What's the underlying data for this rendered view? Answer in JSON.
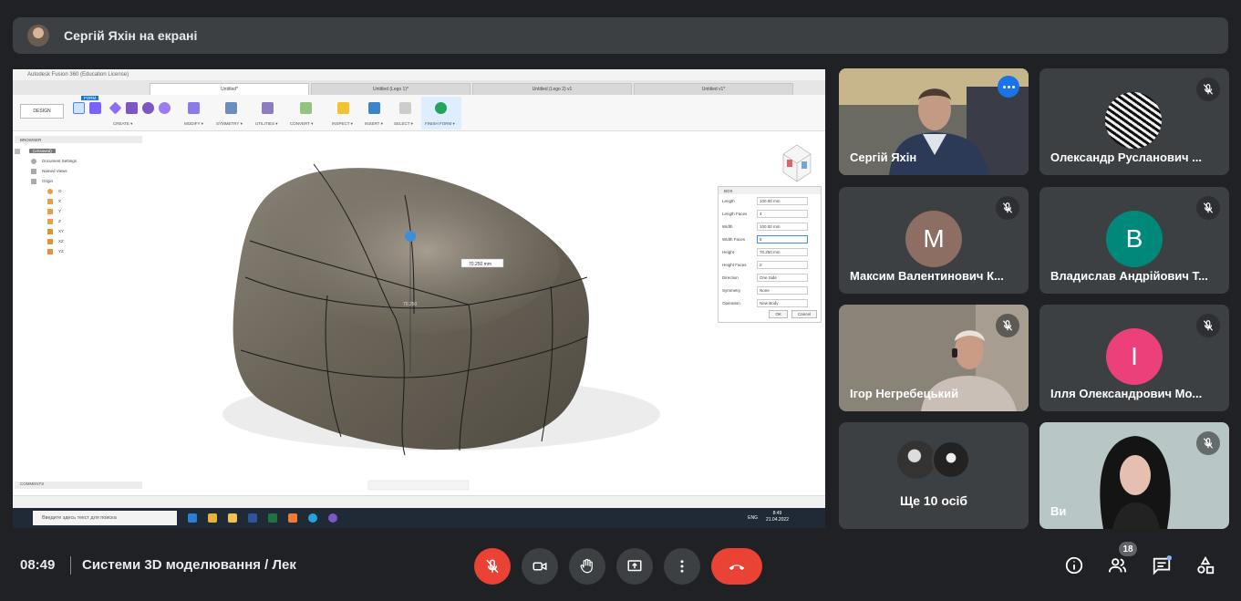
{
  "banner": {
    "presenter_text": "Сергій Яхін на екрані"
  },
  "shared_screen": {
    "window_title": "Autodesk Fusion 360 (Education License)",
    "tabs": [
      "Untitled*",
      "Untitled (Lego 1)*",
      "Untitled (Lego 2) v1",
      "Untitled v1*"
    ],
    "workspace": "DESIGN",
    "toolbar": [
      "CREATE ▾",
      "MODIFY ▾",
      "SYMMETRY ▾",
      "UTILITIES ▾",
      "CONVERT ▾",
      "INSPECT ▾",
      "INSERT ▾",
      "SELECT ▾",
      "FINISH FORM ▾"
    ],
    "form_tab": "FORM",
    "browser": {
      "header": "BROWSER",
      "root": "(Unsaved)",
      "items": [
        "Document Settings",
        "Named Views",
        "Origin",
        "O",
        "X",
        "Y",
        "Z",
        "XY",
        "XZ",
        "YZ"
      ]
    },
    "dimension_label": "70.250 mm",
    "dimension_label_2": "70.250",
    "box_dialog": {
      "title": "BOX",
      "fields": [
        {
          "label": "Length",
          "value": "100.00 mm"
        },
        {
          "label": "Length Faces",
          "value": "4"
        },
        {
          "label": "Width",
          "value": "100.00 mm"
        },
        {
          "label": "Width Faces",
          "value": "5"
        },
        {
          "label": "Height",
          "value": "70.250 mm"
        },
        {
          "label": "Height Faces",
          "value": "2"
        },
        {
          "label": "Direction",
          "value": "One Side"
        },
        {
          "label": "Symmetry",
          "value": "None"
        },
        {
          "label": "Operation",
          "value": "New Body"
        }
      ],
      "ok": "OK",
      "cancel": "Cancel"
    },
    "comments_label": "COMMENTS",
    "taskbar": {
      "search_placeholder": "Введите здесь текст для поиска",
      "lang": "ENG",
      "time": "8:49",
      "date": "21.04.2022"
    }
  },
  "participants": [
    {
      "name": "Сергій Яхін",
      "type": "video",
      "active": true
    },
    {
      "name": "Олександр Русланович ...",
      "type": "image",
      "muted": true
    },
    {
      "name": "Максим Валентинович К...",
      "letter": "M",
      "color": "#8d6e63",
      "muted": true
    },
    {
      "name": "Владислав Андрійович Т...",
      "letter": "B",
      "color": "#00897b",
      "muted": true
    },
    {
      "name": "Ігор Негребецький",
      "type": "video",
      "muted": true
    },
    {
      "name": "Ілля Олександрович Мо...",
      "letter": "I",
      "color": "#ec407a",
      "muted": true
    },
    {
      "name": "Ще 10 осіб",
      "type": "more"
    },
    {
      "name": "Ви",
      "type": "video",
      "muted": true
    }
  ],
  "bottom_bar": {
    "time": "08:49",
    "meeting_title": "Системи 3D моделювання / Лек",
    "people_count": "18"
  }
}
